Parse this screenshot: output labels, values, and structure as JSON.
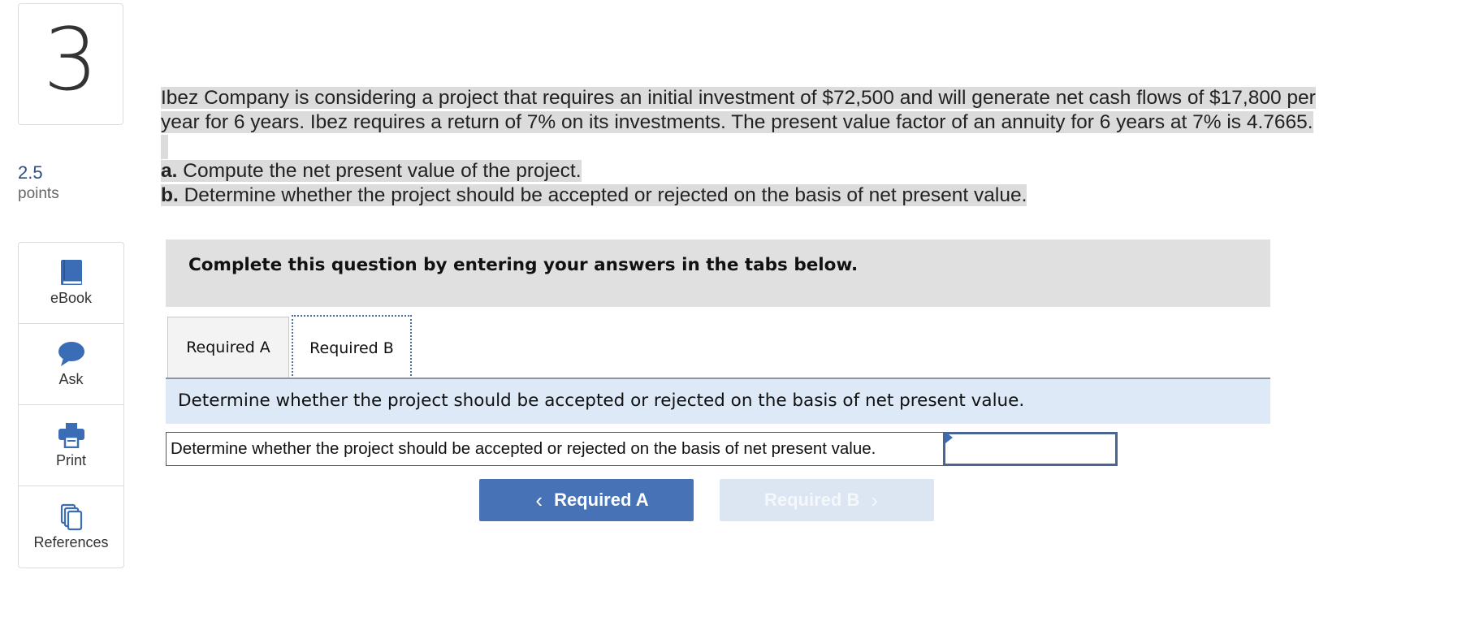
{
  "question": {
    "number": "3",
    "points_value": "2.5",
    "points_label": "points",
    "line1": "Ibez Company is considering a project that requires an initial investment of $72,500 and will generate net cash flows of $17,800 per",
    "line2": "year for 6 years. Ibez requires a return of 7% on its investments. The present value factor of an annuity for 6 years at 7% is 4.7665.",
    "part_a_prefix": "a.",
    "part_a_text": " Compute the net present value of the project.",
    "part_b_prefix": "b.",
    "part_b_text": " Determine whether the project should be accepted or rejected on the basis of net present value."
  },
  "tools": [
    {
      "label": "eBook",
      "icon": "book-icon"
    },
    {
      "label": "Ask",
      "icon": "chat-bubble-icon"
    },
    {
      "label": "Print",
      "icon": "printer-icon"
    },
    {
      "label": "References",
      "icon": "documents-icon"
    }
  ],
  "banner": {
    "text": "Complete this question by entering your answers in the tabs below."
  },
  "tabs": [
    {
      "label": "Required A",
      "active": false
    },
    {
      "label": "Required B",
      "active": true
    }
  ],
  "prompt": {
    "text": "Determine whether the project should be accepted or rejected on the basis of net present value."
  },
  "answer": {
    "label": "Determine whether the project should be accepted or rejected on the basis of net present value.",
    "value": ""
  },
  "nav": {
    "prev_label": "Required A",
    "next_label": "Required B"
  },
  "colors": {
    "accent": "#4773b6",
    "accent_disabled": "#dce6f2",
    "prompt_bg": "#dde9f6",
    "banner_bg": "#e0e0e0",
    "points_color": "#2d4e82",
    "icon_color": "#3a6db5"
  }
}
